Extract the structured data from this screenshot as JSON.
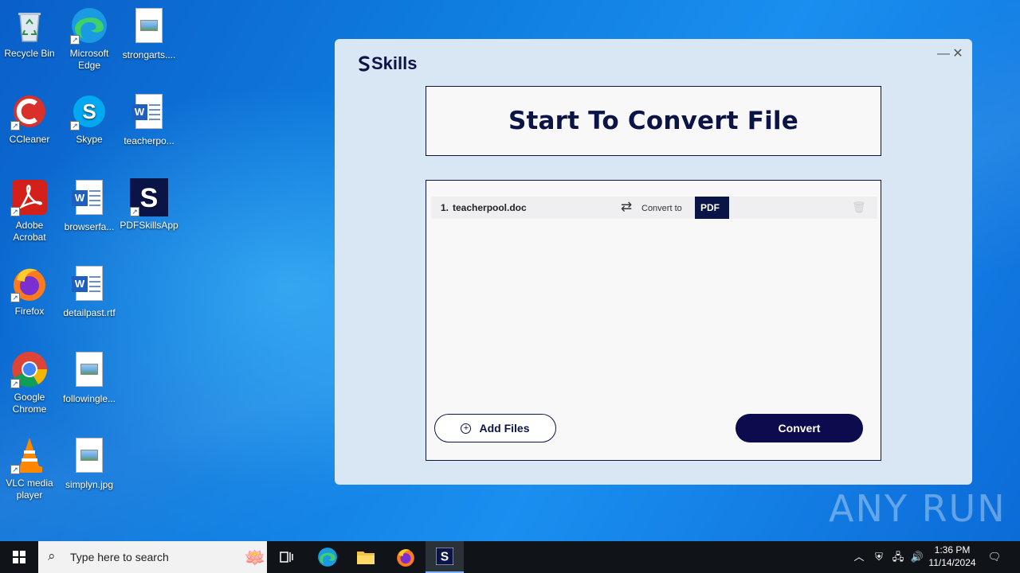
{
  "desktop": {
    "icons": [
      {
        "label": "Recycle Bin"
      },
      {
        "label": "Microsoft Edge"
      },
      {
        "label": "strongarts...."
      },
      {
        "label": "CCleaner"
      },
      {
        "label": "Skype"
      },
      {
        "label": "teacherpo..."
      },
      {
        "label": "Adobe Acrobat"
      },
      {
        "label": "browserfa..."
      },
      {
        "label": "PDFSkillsApp"
      },
      {
        "label": "Firefox"
      },
      {
        "label": "detailpast.rtf"
      },
      {
        "label": "Google Chrome"
      },
      {
        "label": "followingle..."
      },
      {
        "label": "VLC media player"
      },
      {
        "label": "simplyn.jpg"
      }
    ]
  },
  "app": {
    "logo_text": "Skills",
    "heading": "Start To Convert File",
    "files": [
      {
        "index": "1.",
        "name": "teacherpool.doc",
        "convert_label": "Convert to",
        "format": "PDF"
      }
    ],
    "add_files_label": "Add Files",
    "convert_label": "Convert",
    "colors": {
      "primary": "#0b1446",
      "window_bg": "#d9e6f4"
    }
  },
  "watermark": "ANY RUN",
  "taskbar": {
    "search_placeholder": "Type here to search",
    "time": "1:36 PM",
    "date": "11/14/2024"
  }
}
